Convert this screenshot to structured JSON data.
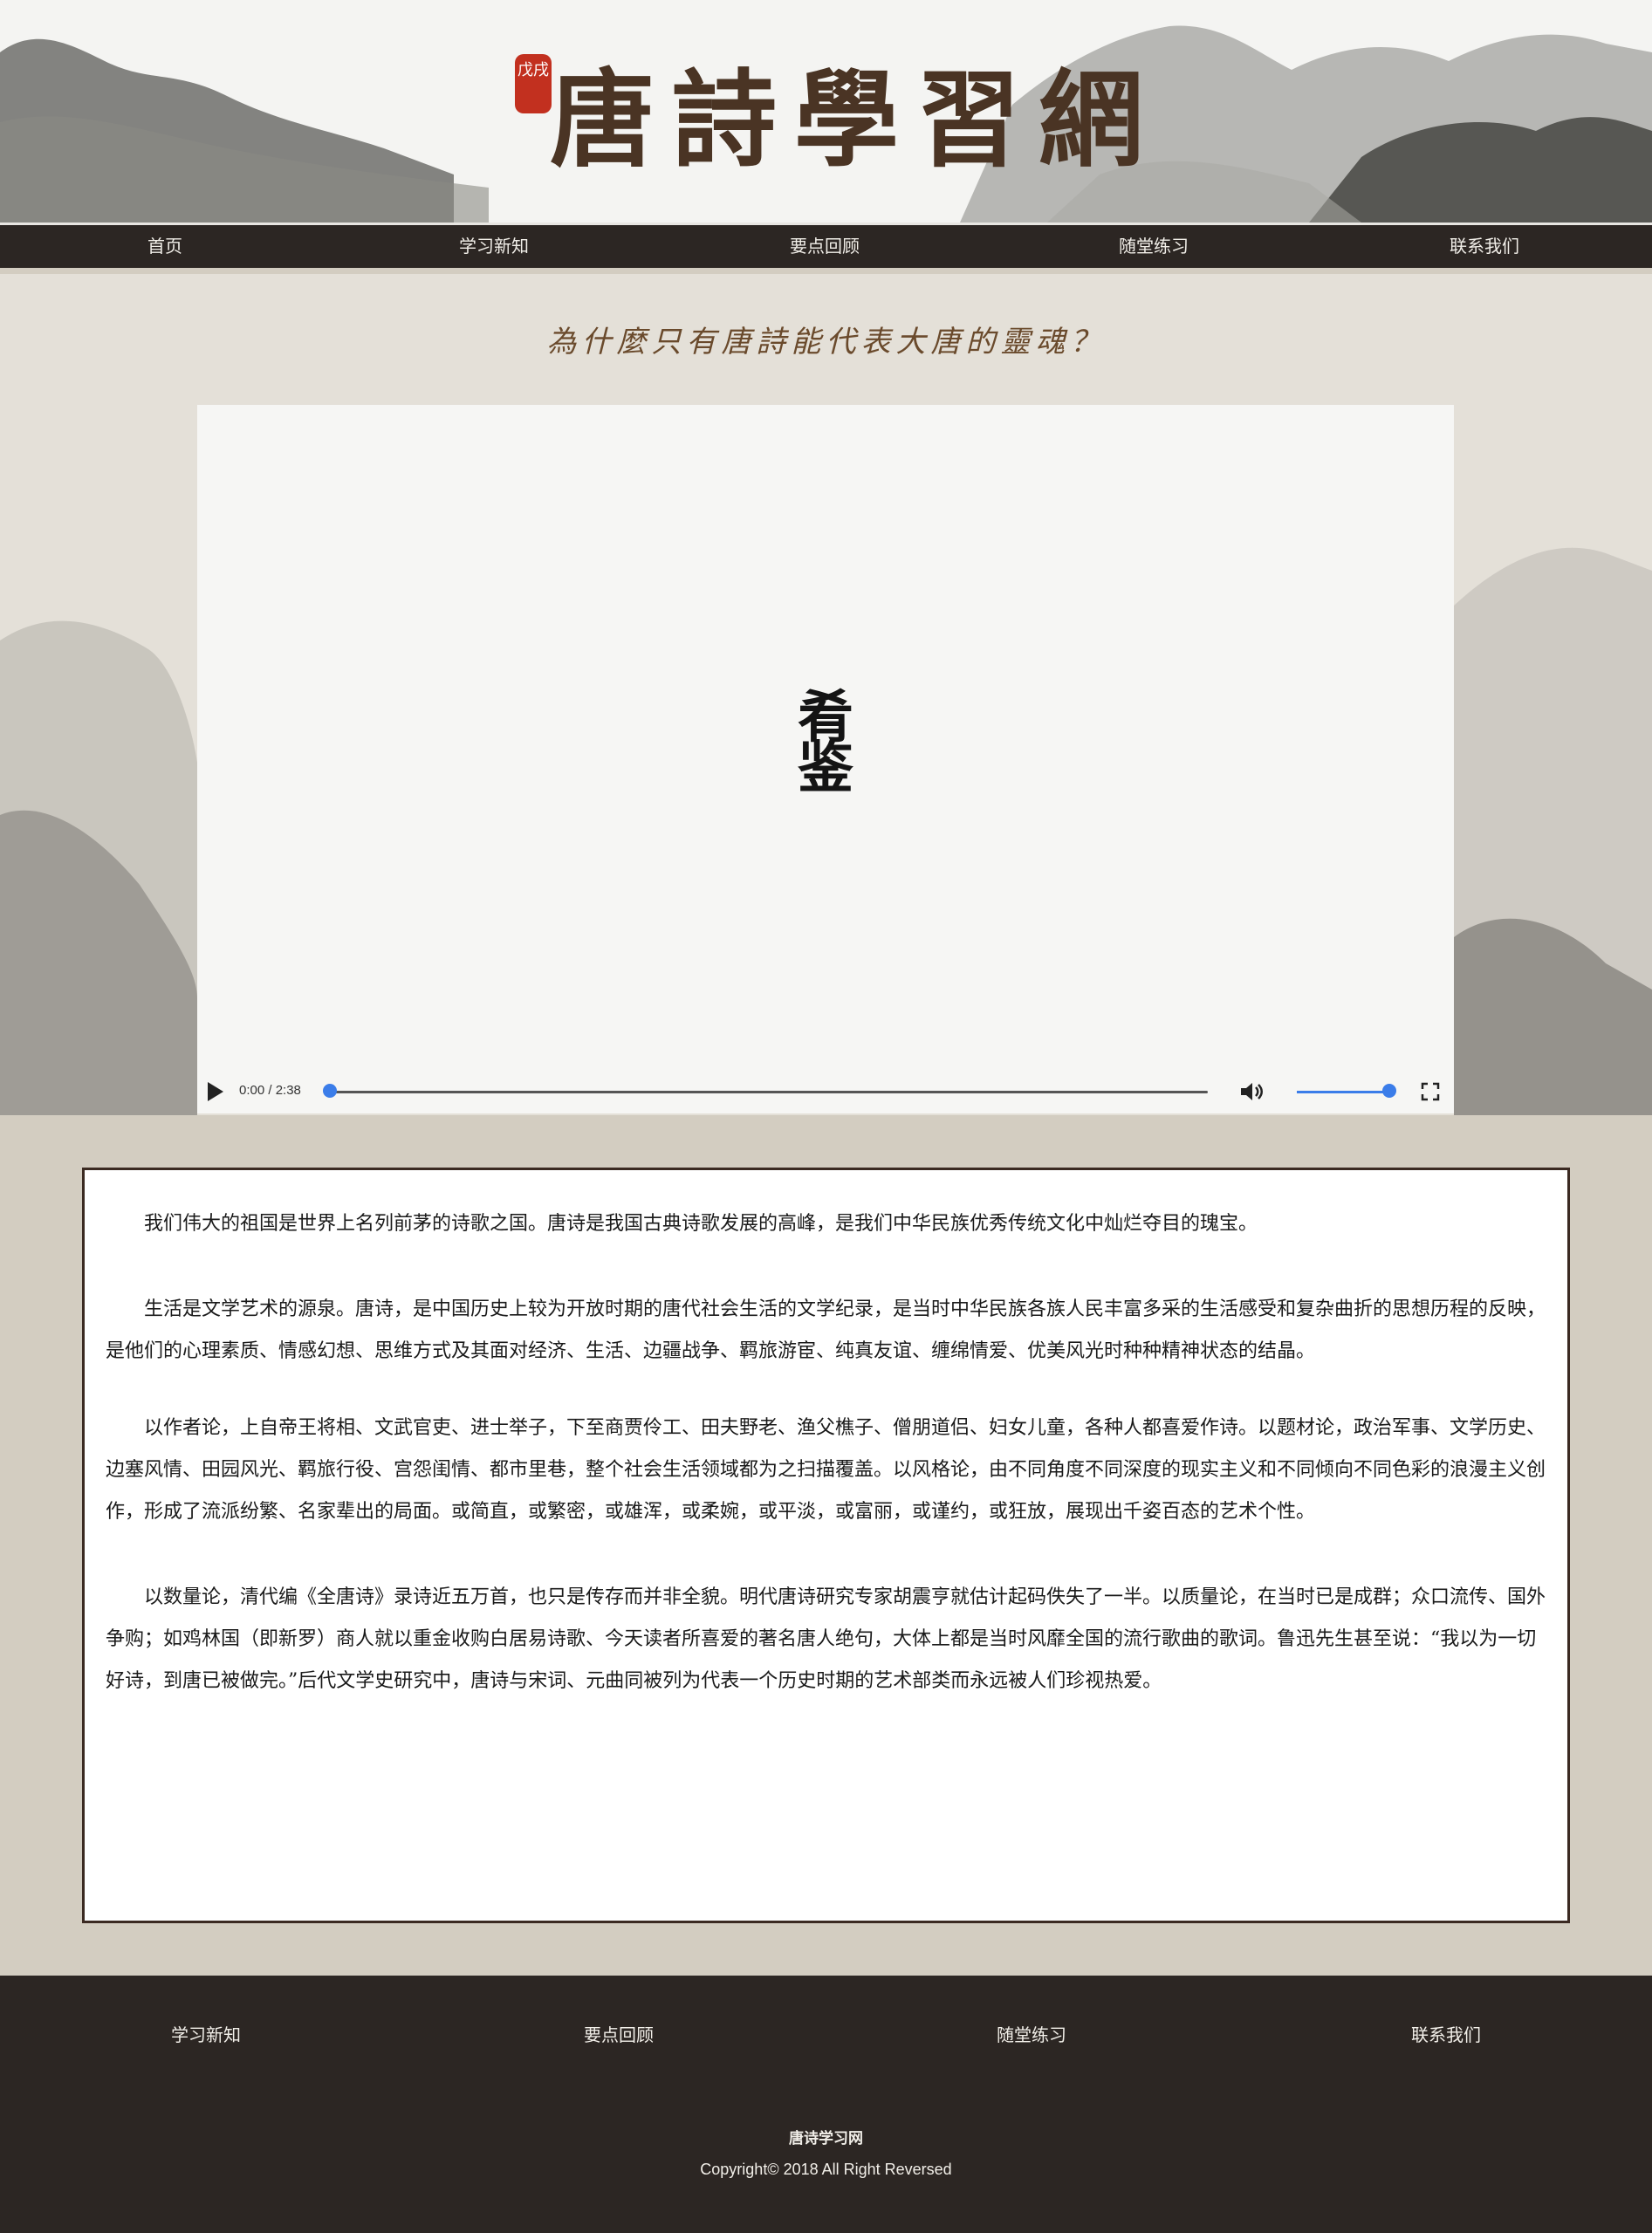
{
  "banner": {
    "title": "唐詩學習網",
    "seal": "戊戌"
  },
  "nav": {
    "items": [
      {
        "label": "首页"
      },
      {
        "label": "学习新知"
      },
      {
        "label": "要点回顾"
      },
      {
        "label": "随堂练习"
      },
      {
        "label": "联系我们"
      }
    ]
  },
  "hero": {
    "heading": "為什麼只有唐詩能代表大唐的靈魂？",
    "video": {
      "logo": "肴鉴",
      "time": "0:00 / 2:38",
      "progress": 0,
      "volume": 1.0
    }
  },
  "article": {
    "paragraphs": [
      "我们伟大的祖国是世界上名列前茅的诗歌之国。唐诗是我国古典诗歌发展的高峰，是我们中华民族优秀传统文化中灿烂夺目的瑰宝。",
      "生活是文学艺术的源泉。唐诗，是中国历史上较为开放时期的唐代社会生活的文学纪录，是当时中华民族各族人民丰富多采的生活感受和复杂曲折的思想历程的反映，是他们的心理素质、情感幻想、思维方式及其面对经济、生活、边疆战争、羁旅游宦、纯真友谊、缠绵情爱、优美风光时种种精神状态的结晶。",
      "以作者论，上自帝王将相、文武官吏、进士举子，下至商贾伶工、田夫野老、渔父樵子、僧朋道侣、妇女儿童，各种人都喜爱作诗。以题材论，政治军事、文学历史、边塞风情、田园风光、羁旅行役、宫怨闺情、都市里巷，整个社会生活领域都为之扫描覆盖。以风格论，由不同角度不同深度的现实主义和不同倾向不同色彩的浪漫主义创作，形成了流派纷繁、名家辈出的局面。或简直，或繁密，或雄浑，或柔婉，或平淡，或富丽，或谨约，或狂放，展现出千姿百态的艺术个性。",
      "以数量论，清代编《全唐诗》录诗近五万首，也只是传存而并非全貌。明代唐诗研究专家胡震亨就估计起码佚失了一半。以质量论，在当时已是成群；众口流传、国外争购；如鸡林国（即新罗）商人就以重金收购白居易诗歌、今天读者所喜爱的著名唐人绝句，大体上都是当时风靡全国的流行歌曲的歌词。鲁迅先生甚至说：“我以为一切好诗，到唐已被做完。”后代文学史研究中，唐诗与宋词、元曲同被列为代表一个历史时期的艺术部类而永远被人们珍视热爱。"
    ]
  },
  "footer": {
    "links": [
      {
        "label": "学习新知"
      },
      {
        "label": "要点回顾"
      },
      {
        "label": "随堂练习"
      },
      {
        "label": "联系我们"
      }
    ],
    "site_name": "唐诗学习网",
    "copyright": "Copyright© 2018 All Right Reversed"
  },
  "colors": {
    "nav_bg": "#2c2623",
    "title_brown": "#4a3424",
    "accent_blue": "#3b7de9",
    "seal_red": "#c2301f",
    "page_bg": "#d3cdc1"
  }
}
